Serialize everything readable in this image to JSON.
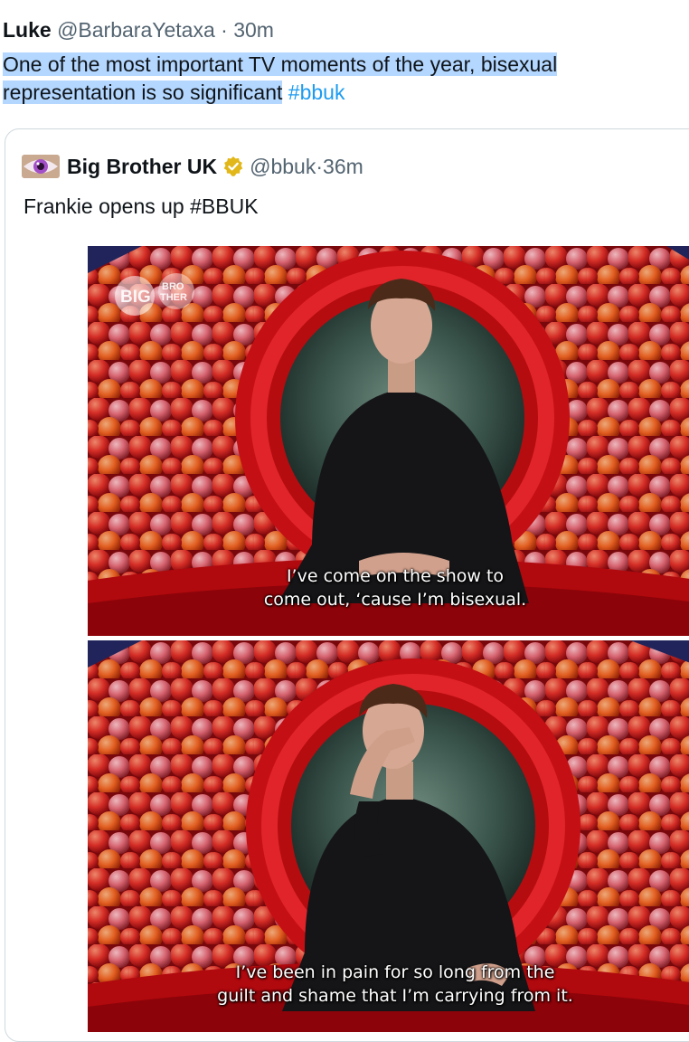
{
  "tweet": {
    "author_name": "Luke",
    "author_handle": "@BarbaraYetaxa",
    "separator": "·",
    "time": "30m",
    "text_line1": "One of the most important TV moments of the year, bisexual",
    "text_line2": "representation is so significant",
    "hashtag": "#bbuk"
  },
  "quoted": {
    "author_name": "Big Brother UK",
    "author_handle": "@bbuk",
    "separator": "·",
    "time": "36m",
    "text": "Frankie opens up #BBUK",
    "avatar_icon": "eye-icon",
    "verified_icon": "verified-badge-icon",
    "logo_text": "BIG BROTHER",
    "subtitle1_line1": "I’ve come on the show to",
    "subtitle1_line2": "come out, ‘cause I’m bisexual.",
    "subtitle2_line1": "I’ve been in pain for so long from the",
    "subtitle2_line2": "guilt and shame that I’m carrying from it."
  },
  "colors": {
    "hashtag": "#1d9bf0",
    "selection": "#b4d7ff",
    "secondary_text": "#536471",
    "verified_gold": "#e2b719",
    "set_red": "#c8161c"
  }
}
